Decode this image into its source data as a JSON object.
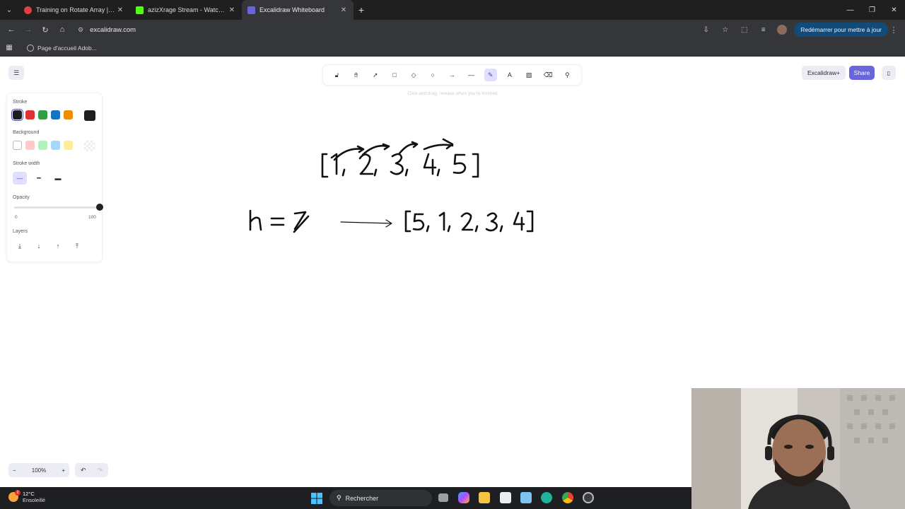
{
  "browser": {
    "tabs": [
      {
        "title": "Training on Rotate Array | Code",
        "favicon_color": "#e04040",
        "active": false
      },
      {
        "title": "azizXrage Stream - Watch Live",
        "favicon_color": "#53fc18",
        "active": false
      },
      {
        "title": "Excalidraw Whiteboard",
        "favicon_color": "#6965db",
        "active": true
      }
    ],
    "new_tab": "+",
    "url": "excalidraw.com",
    "restart_label": "Redémarrer pour mettre à jour",
    "bookmark": "Page d'accueil Adob..."
  },
  "excalidraw": {
    "hint": "Click and drag, release when you're finished",
    "library_label": "Excalidraw+",
    "share_label": "Share",
    "properties": {
      "stroke_label": "Stroke",
      "stroke_colors": [
        "#1e1e1e",
        "#e03131",
        "#2f9e44",
        "#1971c2",
        "#f08c00"
      ],
      "stroke_current": "#1e1e1e",
      "background_label": "Background",
      "background_colors": [
        "transparent",
        "#ffc9c9",
        "#b2f2bb",
        "#a5d8ff",
        "#ffec99"
      ],
      "stroke_width_label": "Stroke width",
      "opacity_label": "Opacity",
      "opacity_min": "0",
      "opacity_max": "100",
      "opacity_value": 1.0,
      "layers_label": "Layers"
    },
    "zoom": "100%",
    "zoom_out": "−",
    "zoom_in": "+"
  },
  "canvas_text": {
    "array_top": "[1, 2, 3, 4, 5]",
    "k_expr": "k = 1",
    "result_array": "[5, 1, 2, 3, 4]"
  },
  "taskbar": {
    "temp": "12°C",
    "weather": "Ensoleillé",
    "badge": "2",
    "search_placeholder": "Rechercher"
  }
}
